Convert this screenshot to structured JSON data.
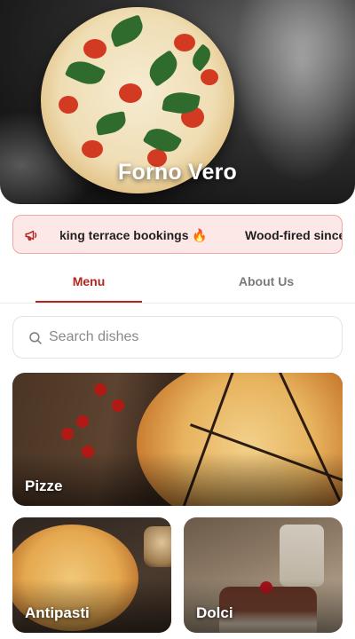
{
  "hero": {
    "title": "Forno Vero"
  },
  "announcement": {
    "icon": "megaphone-icon",
    "items": [
      "king terrace bookings 🔥",
      "Wood-fired since"
    ]
  },
  "tabs": [
    {
      "label": "Menu",
      "active": true
    },
    {
      "label": "About Us",
      "active": false
    }
  ],
  "search": {
    "placeholder": "Search dishes",
    "value": ""
  },
  "categories": [
    {
      "title": "Pizze"
    },
    {
      "title": "Antipasti"
    },
    {
      "title": "Dolci"
    }
  ],
  "colors": {
    "accent": "#b3261e",
    "announcement_bg": "#fde8e8",
    "announcement_border": "#f2a5a5"
  }
}
